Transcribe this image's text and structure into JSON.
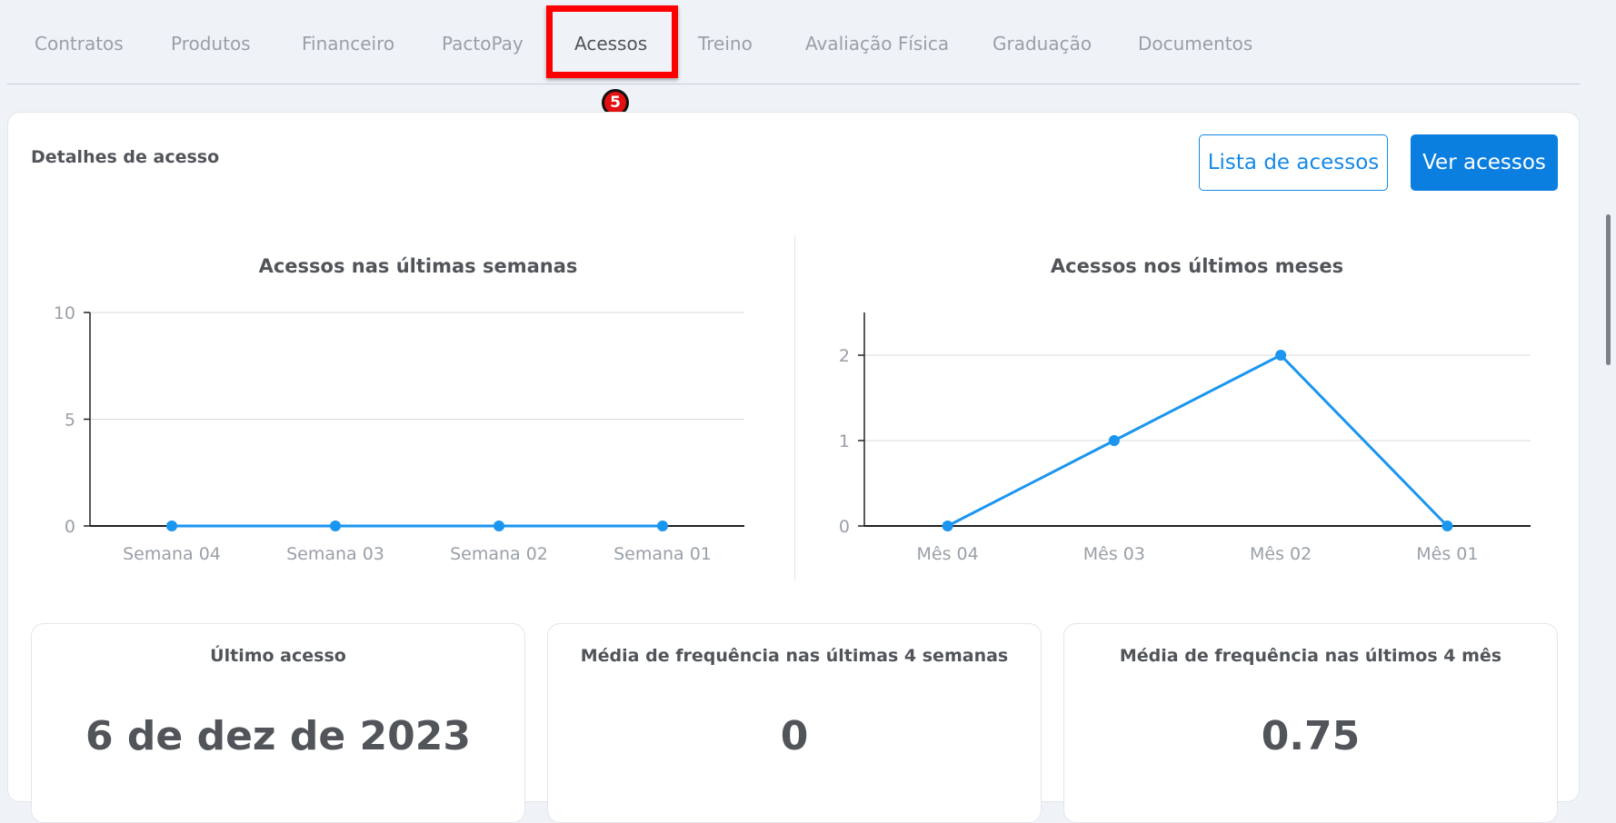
{
  "tabs": [
    "Contratos",
    "Produtos",
    "Financeiro",
    "PactoPay",
    "Acessos",
    "Treino",
    "Avaliação Física",
    "Graduação",
    "Documentos"
  ],
  "active_tab": "Acessos",
  "step_badge": "5",
  "card": {
    "title": "Detalhes de acesso",
    "btn_list": "Lista de acessos",
    "btn_view": "Ver acessos"
  },
  "chart_data": [
    {
      "type": "line",
      "title": "Acessos nas últimas semanas",
      "categories": [
        "Semana 04",
        "Semana 03",
        "Semana 02",
        "Semana 01"
      ],
      "values": [
        0,
        0,
        0,
        0
      ],
      "ylim": [
        0,
        10
      ],
      "yticks": [
        "0",
        "5",
        "10"
      ],
      "grid": true
    },
    {
      "type": "line",
      "title": "Acessos nos últimos meses",
      "categories": [
        "Mês 04",
        "Mês 03",
        "Mês 02",
        "Mês 01"
      ],
      "values": [
        0,
        1,
        2,
        0
      ],
      "ylim": [
        0,
        2.5
      ],
      "yticks": [
        "0",
        "1",
        "2"
      ],
      "grid": true
    }
  ],
  "stats": [
    {
      "label": "Último acesso",
      "value": "6 de dez de 2023"
    },
    {
      "label": "Média de frequência nas últimas 4 semanas",
      "value": "0"
    },
    {
      "label": "Média de frequência nas últimos 4 mês",
      "value": "0.75"
    }
  ],
  "colors": {
    "accent": "#1a95f0",
    "primary_button": "#0b7fe0",
    "highlight": "#ff0000"
  }
}
